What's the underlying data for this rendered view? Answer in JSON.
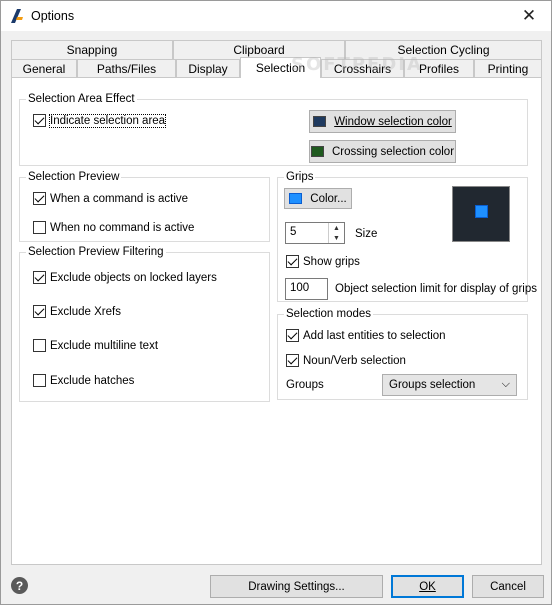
{
  "window": {
    "title": "Options",
    "close_symbol": "✕"
  },
  "watermark": "SOFTPEDIA",
  "tabs": {
    "row1": [
      {
        "label": "Snapping"
      },
      {
        "label": "Clipboard"
      },
      {
        "label": "Selection Cycling"
      }
    ],
    "row2": [
      {
        "label": "General"
      },
      {
        "label": "Paths/Files"
      },
      {
        "label": "Display"
      },
      {
        "label": "Selection",
        "selected": true
      },
      {
        "label": "Crosshairs"
      },
      {
        "label": "Profiles"
      },
      {
        "label": "Printing"
      }
    ]
  },
  "selection_area_effect": {
    "title": "Selection Area Effect",
    "indicate_label": "Indicate selection area",
    "indicate_checked": true,
    "window_color_label": "Window selection color",
    "window_color": "#1f3a5f",
    "crossing_color_label": "Crossing selection color",
    "crossing_color": "#1f5a1f"
  },
  "selection_preview": {
    "title": "Selection Preview",
    "items": [
      {
        "label": "When a command is active",
        "checked": true
      },
      {
        "label": "When no command is active",
        "checked": false
      }
    ]
  },
  "preview_filtering": {
    "title": "Selection Preview Filtering",
    "items": [
      {
        "label": "Exclude objects on locked layers",
        "checked": true
      },
      {
        "label": "Exclude Xrefs",
        "checked": true
      },
      {
        "label": "Exclude multiline text",
        "checked": false
      },
      {
        "label": "Exclude hatches",
        "checked": false
      }
    ]
  },
  "grips": {
    "title": "Grips",
    "color_button_label": "Color...",
    "grip_color": "#1e90ff",
    "size_value": "5",
    "size_label": "Size",
    "show_grips_label": "Show grips",
    "show_grips_checked": true,
    "limit_value": "100",
    "limit_label": "Object selection limit for display of grips",
    "preview_bg": "#212830"
  },
  "selection_modes": {
    "title": "Selection modes",
    "add_last_label": "Add last entities to selection",
    "add_last_checked": true,
    "noun_verb_label": "Noun/Verb selection",
    "noun_verb_checked": true,
    "groups_label": "Groups",
    "groups_value": "Groups selection"
  },
  "footer": {
    "help_symbol": "?",
    "drawing_settings_label": "Drawing Settings...",
    "ok_label": "OK",
    "cancel_label": "Cancel"
  }
}
